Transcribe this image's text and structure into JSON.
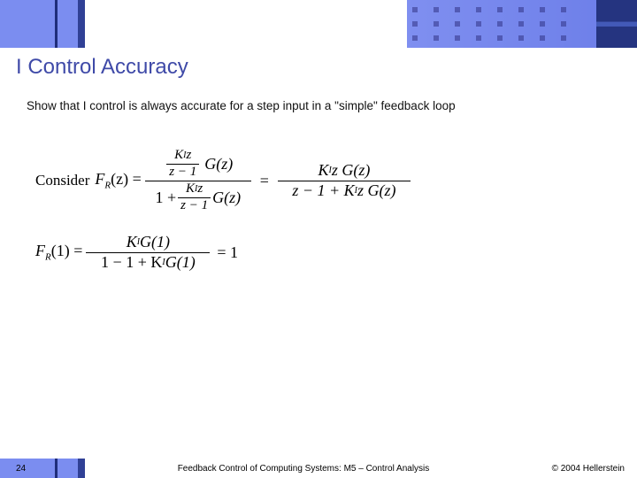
{
  "header": {
    "title": "I Control Accuracy"
  },
  "body": {
    "subtext": "Show that I control is always accurate for a step input in a \"simple\" feedback loop",
    "equation1": {
      "lead": "Consider",
      "lhs_var": "F",
      "lhs_sub": "R",
      "lhs_arg": "(z) =",
      "mid_num_K": "K",
      "mid_num_I": "I",
      "mid_num_z": "z",
      "mid_num_Gz": "G(z)",
      "mid_inner_den": "z − 1",
      "mid_den_lead": "1 +",
      "eq_sign": "=",
      "right_num": "K",
      "right_num_sub": "I",
      "right_num_rest": " z G(z)",
      "right_den_a": "z − 1 + K",
      "right_den_sub": "I",
      "right_den_b": " z G(z)"
    },
    "equation2": {
      "lhs_var": "F",
      "lhs_sub": "R",
      "lhs_arg": "(1) =",
      "num_K": "K",
      "num_I": "I",
      "num_rest": " G(1)",
      "den_a": "1 − 1 + K",
      "den_sub": "I",
      "den_b": " G(1)",
      "tail": "= 1"
    }
  },
  "footer": {
    "page": "24",
    "center": "Feedback Control of Computing Systems: M5 – Control Analysis",
    "right": "© 2004 Hellerstein"
  }
}
